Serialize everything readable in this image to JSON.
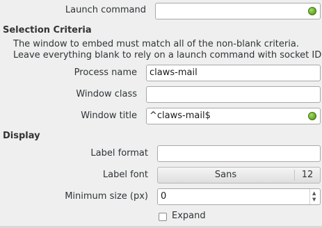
{
  "launch": {
    "label": "Launch command",
    "value": ""
  },
  "selection": {
    "heading": "Selection Criteria",
    "description_line1": "The window to embed must match all of the non-blank criteria.",
    "description_line2": "Leave everything blank to rely on a launch command with socket ID.",
    "process_name": {
      "label": "Process name",
      "value": "claws-mail"
    },
    "window_class": {
      "label": "Window class",
      "value": ""
    },
    "window_title": {
      "label": "Window title",
      "value": "^claws-mail$"
    }
  },
  "display": {
    "heading": "Display",
    "label_format": {
      "label": "Label format",
      "value": ""
    },
    "label_font": {
      "label": "Label font",
      "font_name": "Sans",
      "font_size": "12"
    },
    "minimum_size": {
      "label": "Minimum size (px)",
      "value": "0"
    },
    "expand": {
      "label": "Expand",
      "checked": false
    }
  },
  "colors": {
    "valid_indicator": "#6fb22c"
  },
  "icons": {
    "valid": "green-dot-icon",
    "spin_up": "up-arrow-icon",
    "spin_down": "down-arrow-icon"
  }
}
